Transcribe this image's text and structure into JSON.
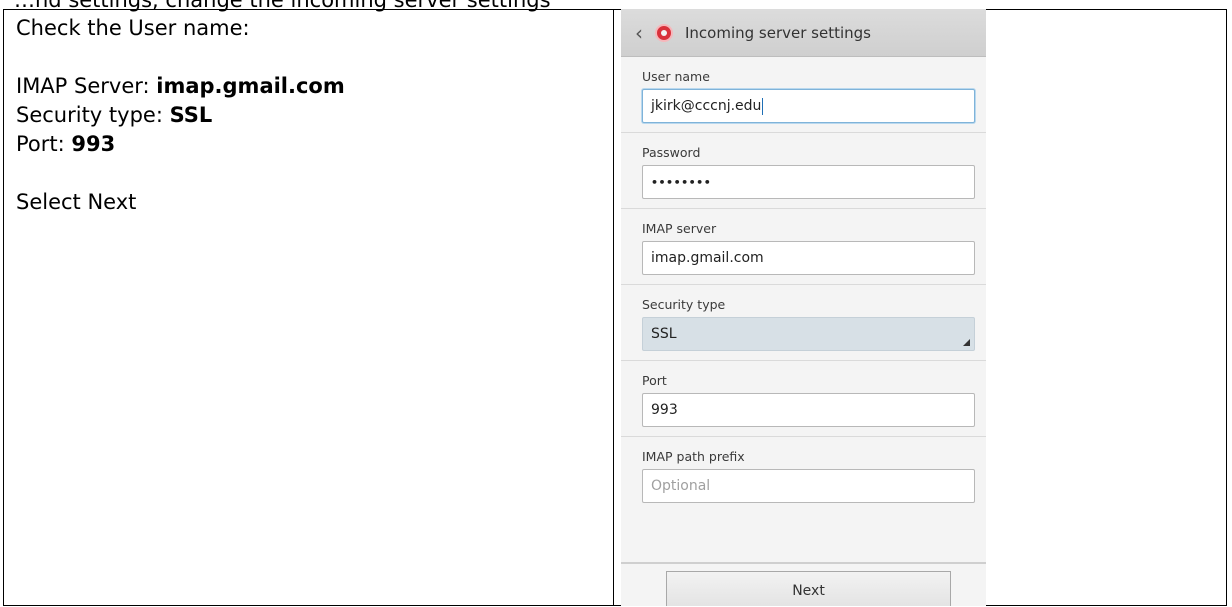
{
  "document": {
    "clipped_top_line": "…nd settings, change the incoming server settings",
    "left_cell": {
      "line1": "Check the User name:",
      "imap_label": "IMAP Server: ",
      "imap_value": "imap.gmail.com",
      "security_label": "Security type: ",
      "security_value": "SSL",
      "port_label": "Port: ",
      "port_value": "993",
      "select_next": "Select Next"
    }
  },
  "phone": {
    "header": {
      "back_icon": "chevron-left-icon",
      "app_icon": "email-app-icon",
      "title": "Incoming server settings"
    },
    "fields": {
      "user_name": {
        "label": "User name",
        "value": "jkirk@cccnj.edu"
      },
      "password": {
        "label": "Password",
        "value": "••••••••"
      },
      "imap_server": {
        "label": "IMAP server",
        "value": "imap.gmail.com"
      },
      "security_type": {
        "label": "Security type",
        "value": "SSL"
      },
      "port": {
        "label": "Port",
        "value": "993"
      },
      "imap_path_prefix": {
        "label": "IMAP path prefix",
        "placeholder": "Optional"
      }
    },
    "next_label": "Next"
  }
}
